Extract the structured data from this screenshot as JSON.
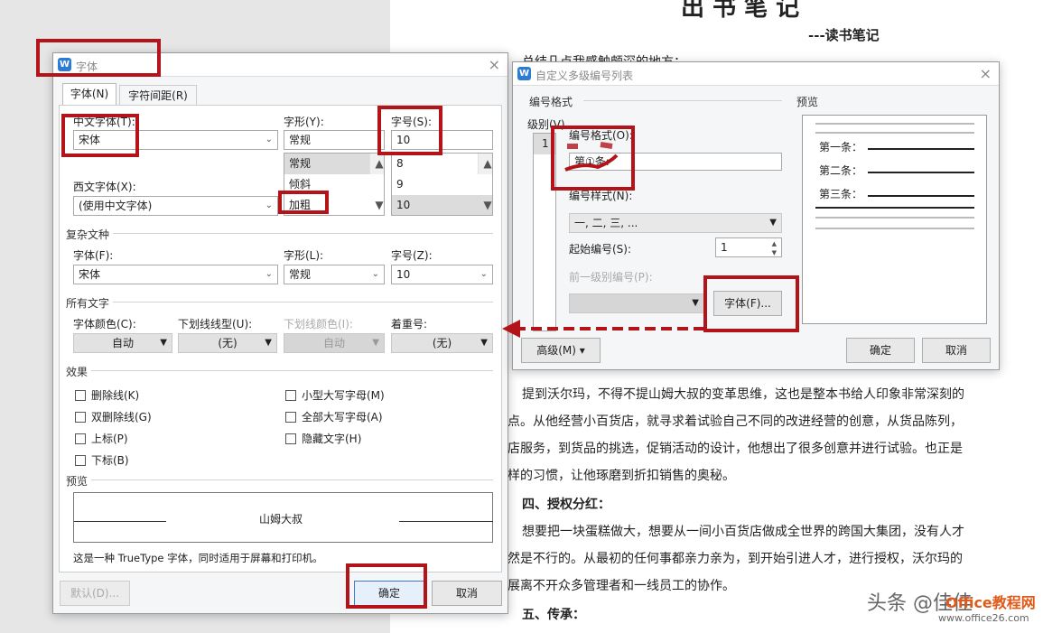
{
  "doc": {
    "title_frag": "出 书 笔 记",
    "subtitle": "---读书笔记",
    "line1": "总结几点我感触颇深的地方：",
    "para1": [
      "提到沃尔玛，不得不提山姆大叔的变革思维，这也是整本书给人印象非常深刻的",
      "点。从他经营小百货店，就寻求着试验自己不同的改进经营的创意，从货品陈列，",
      "店服务，到货品的挑选，促销活动的设计，他想出了很多创意并进行试验。也正是",
      "样的习惯，让他琢磨到折扣销售的奥秘。"
    ],
    "heading4": "四、授权分红：",
    "para2": [
      "想要把一块蛋糕做大，想要从一间小百货店做成全世界的跨国大集团，没有人才",
      "然是不行的。从最初的任何事都亲力亲为，到开始引进人才，进行授权，沃尔玛的",
      "展离不开众多管理者和一线员工的协作。"
    ],
    "heading5": "五、传承：",
    "watermark": "头条 @佳佳",
    "watermark2": "Office教程网",
    "watermark_url": "www.office26.com"
  },
  "font_dialog": {
    "title": "字体",
    "tabs": [
      "字体(N)",
      "字符间距(R)"
    ],
    "cn_font_label": "中文字体(T):",
    "cn_font_value": "宋体",
    "style_label": "字形(Y):",
    "style_value": "常规",
    "size_label": "字号(S):",
    "size_value": "10",
    "style_list": [
      "常规",
      "倾斜",
      "加粗"
    ],
    "size_list": [
      "8",
      "9",
      "10"
    ],
    "west_font_label": "西文字体(X):",
    "west_font_value": "(使用中文字体)",
    "complex_section": "复杂文种",
    "complex_font_label": "字体(F):",
    "complex_font_value": "宋体",
    "complex_style_label": "字形(L):",
    "complex_style_value": "常规",
    "complex_size_label": "字号(Z):",
    "complex_size_value": "10",
    "all_text_section": "所有文字",
    "color_label": "字体颜色(C):",
    "color_value": "自动",
    "underline_label": "下划线线型(U):",
    "underline_value": "(无)",
    "ucolor_label": "下划线颜色(I):",
    "ucolor_value": "自动",
    "emph_label": "着重号:",
    "emph_value": "(无)",
    "effects_section": "效果",
    "effects_left": [
      "删除线(K)",
      "双删除线(G)",
      "上标(P)",
      "下标(B)"
    ],
    "effects_right": [
      "小型大写字母(M)",
      "全部大写字母(A)",
      "隐藏文字(H)"
    ],
    "preview_section": "预览",
    "preview_text": "山姆大叔",
    "note": "这是一种 TrueType 字体，同时适用于屏幕和打印机。",
    "default_btn": "默认(D)...",
    "ok_btn": "确定",
    "cancel_btn": "取消"
  },
  "list_dialog": {
    "title": "自定义多级编号列表",
    "format_section": "编号格式",
    "level_label": "级别(V)",
    "level_value": "1",
    "num_format_label": "编号格式(O):",
    "num_format_value": "第①条:",
    "num_style_label": "编号样式(N):",
    "num_style_value": "一, 二, 三, ...",
    "start_label": "起始编号(S):",
    "start_value": "1",
    "prev_label": "前一级别编号(P):",
    "font_btn": "字体(F)...",
    "preview_section": "预览",
    "preview_items": [
      "第一条：",
      "第二条：",
      "第三条："
    ],
    "advanced_btn": "高级(M)",
    "ok_btn": "确定",
    "cancel_btn": "取消"
  },
  "colors": {
    "annotation_red": "#b3141a",
    "wps_blue": "#2b7cd3"
  }
}
